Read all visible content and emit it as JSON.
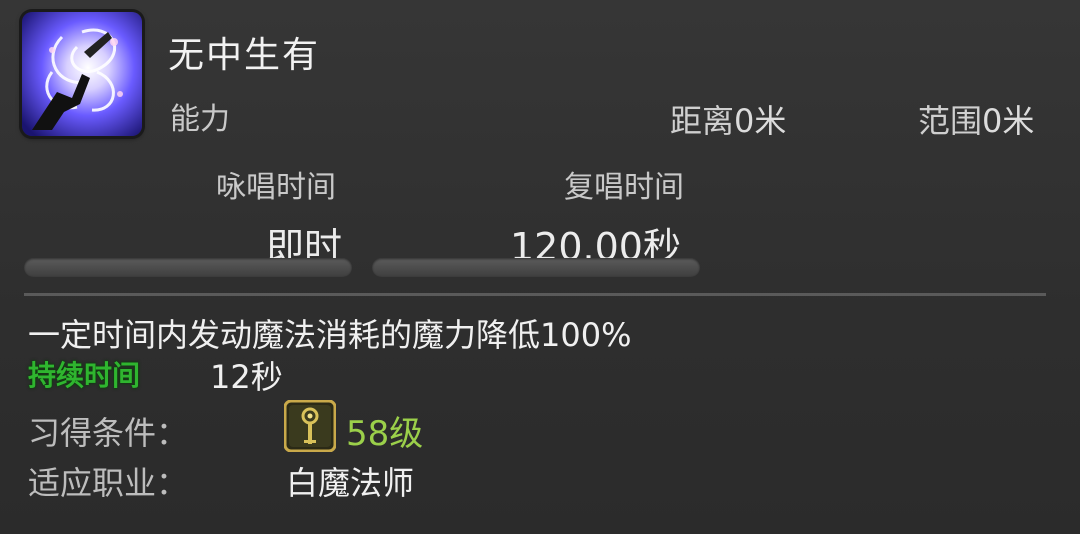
{
  "skill": {
    "name": "无中生有",
    "type": "能力",
    "icon": "white-swirl-magic-icon"
  },
  "stats": {
    "range_label": "距离",
    "range_value": "0米",
    "radius_label": "范围",
    "radius_value": "0米"
  },
  "timing": {
    "cast_label": "咏唱时间",
    "cast_value": "即时",
    "recast_label": "复唱时间",
    "recast_value": "120.00秒"
  },
  "description": "一定时间内发动魔法消耗的魔力降低100%",
  "duration": {
    "label": "持续时间",
    "value": "12秒"
  },
  "requirements": {
    "level_label": "习得条件：",
    "level_value": "58级",
    "job_label": "适应职业：",
    "job_value": "白魔法师",
    "job_icon": "white-mage-staff-icon"
  },
  "colors": {
    "panel_bg": "#2e2e2e",
    "duration_green": "#2fb52f",
    "level_green": "#9bd04a"
  }
}
